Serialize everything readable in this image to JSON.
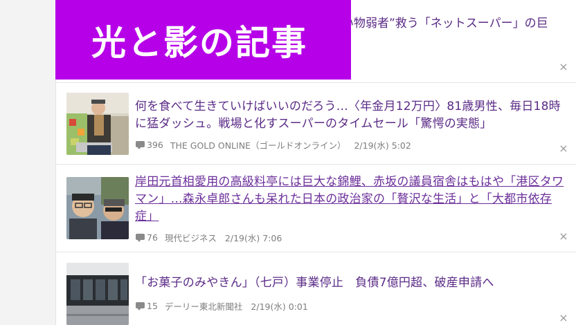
{
  "banner": {
    "text": "光と影の記事"
  },
  "items": [
    {
      "title": "い物弱者”救う「ネットスーパー」の巨",
      "close": "×"
    },
    {
      "title": "何を食べて生きていけばいいのだろう…〈年金月12万円〉81歳男性、毎日18時に猛ダッシュ。戦場と化すスーパーのタイムセール「驚愕の実態」",
      "comments": "396",
      "source": "THE GOLD ONLINE（ゴールドオンライン）",
      "time": "2/19(水) 5:02",
      "close": "×"
    },
    {
      "title": "岸田元首相愛用の高級料亭には巨大な錦鯉、赤坂の議員宿舎はもはや「港区タワマン」…森永卓郎さんも呆れた日本の政治家の「贅沢な生活」と「大都市依存症」",
      "comments": "76",
      "source": "現代ビジネス",
      "time": "2/19(水) 7:06",
      "close": "×"
    },
    {
      "title": "「お菓子のみやきん」（七戸）事業停止　負債7億円超、破産申請へ",
      "comments": "15",
      "source": "デーリー東北新聞社",
      "time": "2/19(水) 0:01",
      "close": "×"
    }
  ],
  "colors": {
    "banner_bg": "#b600e8",
    "title_link": "#5a2a86",
    "meta_text": "#7d7d7d"
  }
}
